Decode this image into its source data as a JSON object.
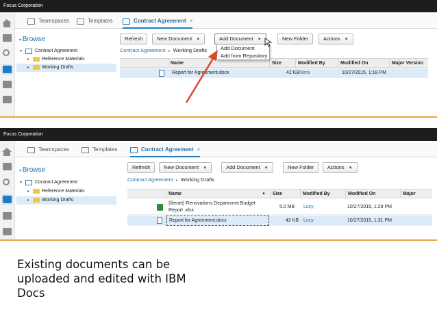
{
  "panel1": {
    "title": "Focus Corporation",
    "tabs": [
      {
        "label": "Teamspaces"
      },
      {
        "label": "Templates"
      },
      {
        "label": "Contract Agreement",
        "close": "×"
      }
    ],
    "nav": {
      "heading": "Browse",
      "items": [
        {
          "label": "Contract Agreement"
        },
        {
          "label": "Reference Materials"
        },
        {
          "label": "Working Drafts"
        }
      ]
    },
    "toolbar": {
      "refresh": "Refresh",
      "new_document": "New Document",
      "add_document": "Add Document",
      "new_folder": "New Folder",
      "actions": "Actions"
    },
    "dropdown": {
      "items": [
        "Add Document",
        "Add from Repository"
      ]
    },
    "breadcrumb": {
      "root": "Contract Agreement",
      "current": "Working Drafts"
    },
    "columns": [
      "Name",
      "Size",
      "Modified By",
      "Modified On",
      "Major Version"
    ],
    "rows": [
      {
        "name": "Report for Agreement.docx",
        "size": "42 KB",
        "modified_by": "Nora",
        "modified_on": "10/27/2015, 1:18 PM"
      }
    ]
  },
  "panel2": {
    "title": "Focus Corporation",
    "tabs": [
      {
        "label": "Teamspaces"
      },
      {
        "label": "Templates"
      },
      {
        "label": "Contract Agreement",
        "close": "×"
      }
    ],
    "nav": {
      "heading": "Browse",
      "items": [
        {
          "label": "Contract Agreement"
        },
        {
          "label": "Reference Materials"
        },
        {
          "label": "Working Drafts"
        }
      ]
    },
    "toolbar": {
      "refresh": "Refresh",
      "new_document": "New Document",
      "add_document": "Add Document",
      "new_folder": "New Folder",
      "actions": "Actions"
    },
    "breadcrumb": {
      "root": "Contract Agreement",
      "current": "Working Drafts"
    },
    "columns": [
      "Name",
      "Size",
      "Modified By",
      "Modified On",
      "Major"
    ],
    "rows": [
      {
        "name_line1": "(filenet) Renovations Department Budget",
        "name_line2": "Report .xlsx",
        "size": "5.0 MB",
        "modified_by": "Lucy",
        "modified_on": "10/27/2015, 1:29 PM"
      },
      {
        "name": "Report for Agreement.docx",
        "size": "42 KB",
        "modified_by": "Lucy",
        "modified_on": "10/27/2015, 1:31 PM"
      }
    ]
  },
  "caption": {
    "line1": "Existing documents can be",
    "line2": "uploaded and edited with IBM",
    "line3": "Docs"
  },
  "colors": {
    "accent": "#1f7cc0",
    "arrow": "#e0442a",
    "rule": "#e8a33a"
  }
}
